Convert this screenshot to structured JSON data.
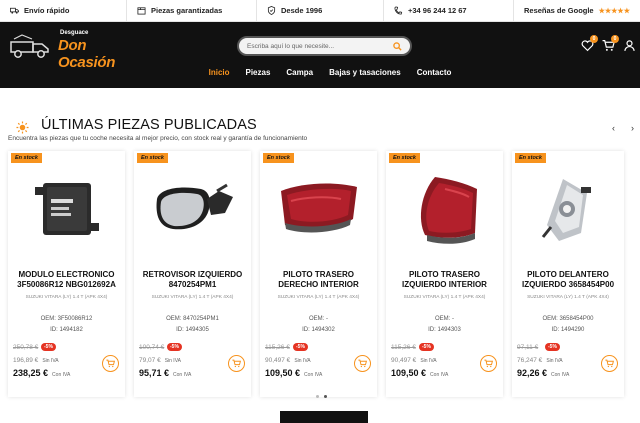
{
  "topbar": {
    "shipping": "Envío rápido",
    "guarantee": "Piezas garantizadas",
    "since": "Desde 1996",
    "phone": "+34 96 244 12 67",
    "reviews": "Reseñas de Google",
    "stars": "★★★★★"
  },
  "logo": {
    "sub": "Desguace",
    "name": "Don Ocasión"
  },
  "search": {
    "placeholder": "Escriba aquí lo que necesite..."
  },
  "header_icons": {
    "wishlist_count": "0",
    "cart_count": "0"
  },
  "nav": [
    "Inicio",
    "Piezas",
    "Campa",
    "Bajas y tasaciones",
    "Contacto"
  ],
  "section": {
    "title": "ÚLTIMAS PIEZAS PUBLICADAS",
    "subtitle": "Encuentra las piezas que tu coche necesita al mejor precio, con stock real y garantía de funcionamiento",
    "prev": "‹",
    "next": "›"
  },
  "labels": {
    "stock": "En stock",
    "sin_iva": "Sin IVA",
    "con_iva": "Con IVA"
  },
  "cards": [
    {
      "title": "MODULO ELECTRONICO 3F50086R12 NBG012692A",
      "model": "SUZUKI VITARA (LY) 1.4 T (APK 4X4)",
      "oem": "OEM: 3F50086R12",
      "id": "ID: 1494182",
      "old": "250,78 €",
      "disc": "-5%",
      "sin": "196,89 €",
      "con": "238,25 €"
    },
    {
      "title": "RETROVISOR IZQUIERDO 8470254PM1",
      "model": "SUZUKI VITARA (LY) 1.4 T (APK 4X4)",
      "oem": "OEM: 8470254PM1",
      "id": "ID: 1494305",
      "old": "100,74 €",
      "disc": "-5%",
      "sin": "79,07 €",
      "con": "95,71 €"
    },
    {
      "title": "PILOTO TRASERO DERECHO INTERIOR",
      "model": "SUZUKI VITARA (LY) 1.4 T (APK 4X4)",
      "oem": "OEM: -",
      "id": "ID: 1494302",
      "old": "115,26 €",
      "disc": "-5%",
      "sin": "90,497 €",
      "con": "109,50 €"
    },
    {
      "title": "PILOTO TRASERO IZQUIERDO INTERIOR",
      "model": "SUZUKI VITARA (LY) 1.4 T (APK 4X4)",
      "oem": "OEM: -",
      "id": "ID: 1494303",
      "old": "115,26 €",
      "disc": "-5%",
      "sin": "90,497 €",
      "con": "109,50 €"
    },
    {
      "title": "PILOTO DELANTERO IZQUIERDO 3658454P00",
      "model": "SUZUKI VITARA (LY) 1.4 T (APK 4X4)",
      "oem": "OEM: 3658454P00",
      "id": "ID: 1494290",
      "old": "97,11 €",
      "disc": "-5%",
      "sin": "76,247 €",
      "con": "92,26 €"
    }
  ],
  "colors": {
    "accent": "#f7931e",
    "header_bg": "#111111",
    "discount": "#e53322"
  }
}
